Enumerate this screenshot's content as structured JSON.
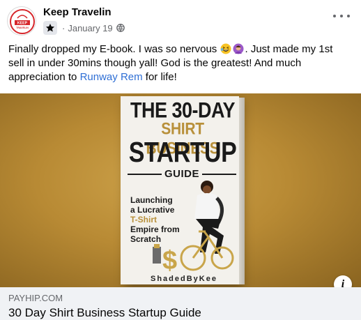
{
  "post": {
    "page_name": "Keep Travelin",
    "avatar_text": "KEEP TRAVELIN",
    "date": "January 19",
    "separator": "·",
    "audience_icon": "globe-icon",
    "badge_icon": "star-badge-icon",
    "more_icon": "more-options-icon",
    "text": {
      "line1_before": "Finally dropped my E-book. I was so nervous",
      "line1_after": ". Just made my 1st",
      "line2": "sell in under 30mins though yall! God is the greatest! And much",
      "line3_before": "appreciation to ",
      "mention": "Runway Rem",
      "line3_after": " for life!"
    },
    "emojis": [
      "grinning-squinting-face-emoji",
      "person-gesturing-emoji"
    ]
  },
  "media": {
    "book_cover": {
      "title_line1": "THE 30-DAY",
      "title_line2": "SHIRT BUSINESS",
      "title_line3": "STARTUP",
      "guide_word": "GUIDE",
      "subtitle_lines_dark": [
        "Launching",
        "a Lucrative"
      ],
      "subtitle_lines_gold": [
        "T-Shirt",
        "Empire from",
        "Scratch"
      ],
      "author": "ShadedByKee"
    },
    "info_label": "i",
    "info_icon": "info-icon"
  },
  "link_preview": {
    "domain": "PAYHIP.COM",
    "title": "30 Day Shirt Business Startup Guide"
  },
  "colors": {
    "mention": "#2f6fd5",
    "meta_text": "#65676b",
    "cover_gold": "#b8903a",
    "media_bg": "#b88a34",
    "preview_bg": "#f0f2f5",
    "avatar_red": "#d6262b"
  }
}
